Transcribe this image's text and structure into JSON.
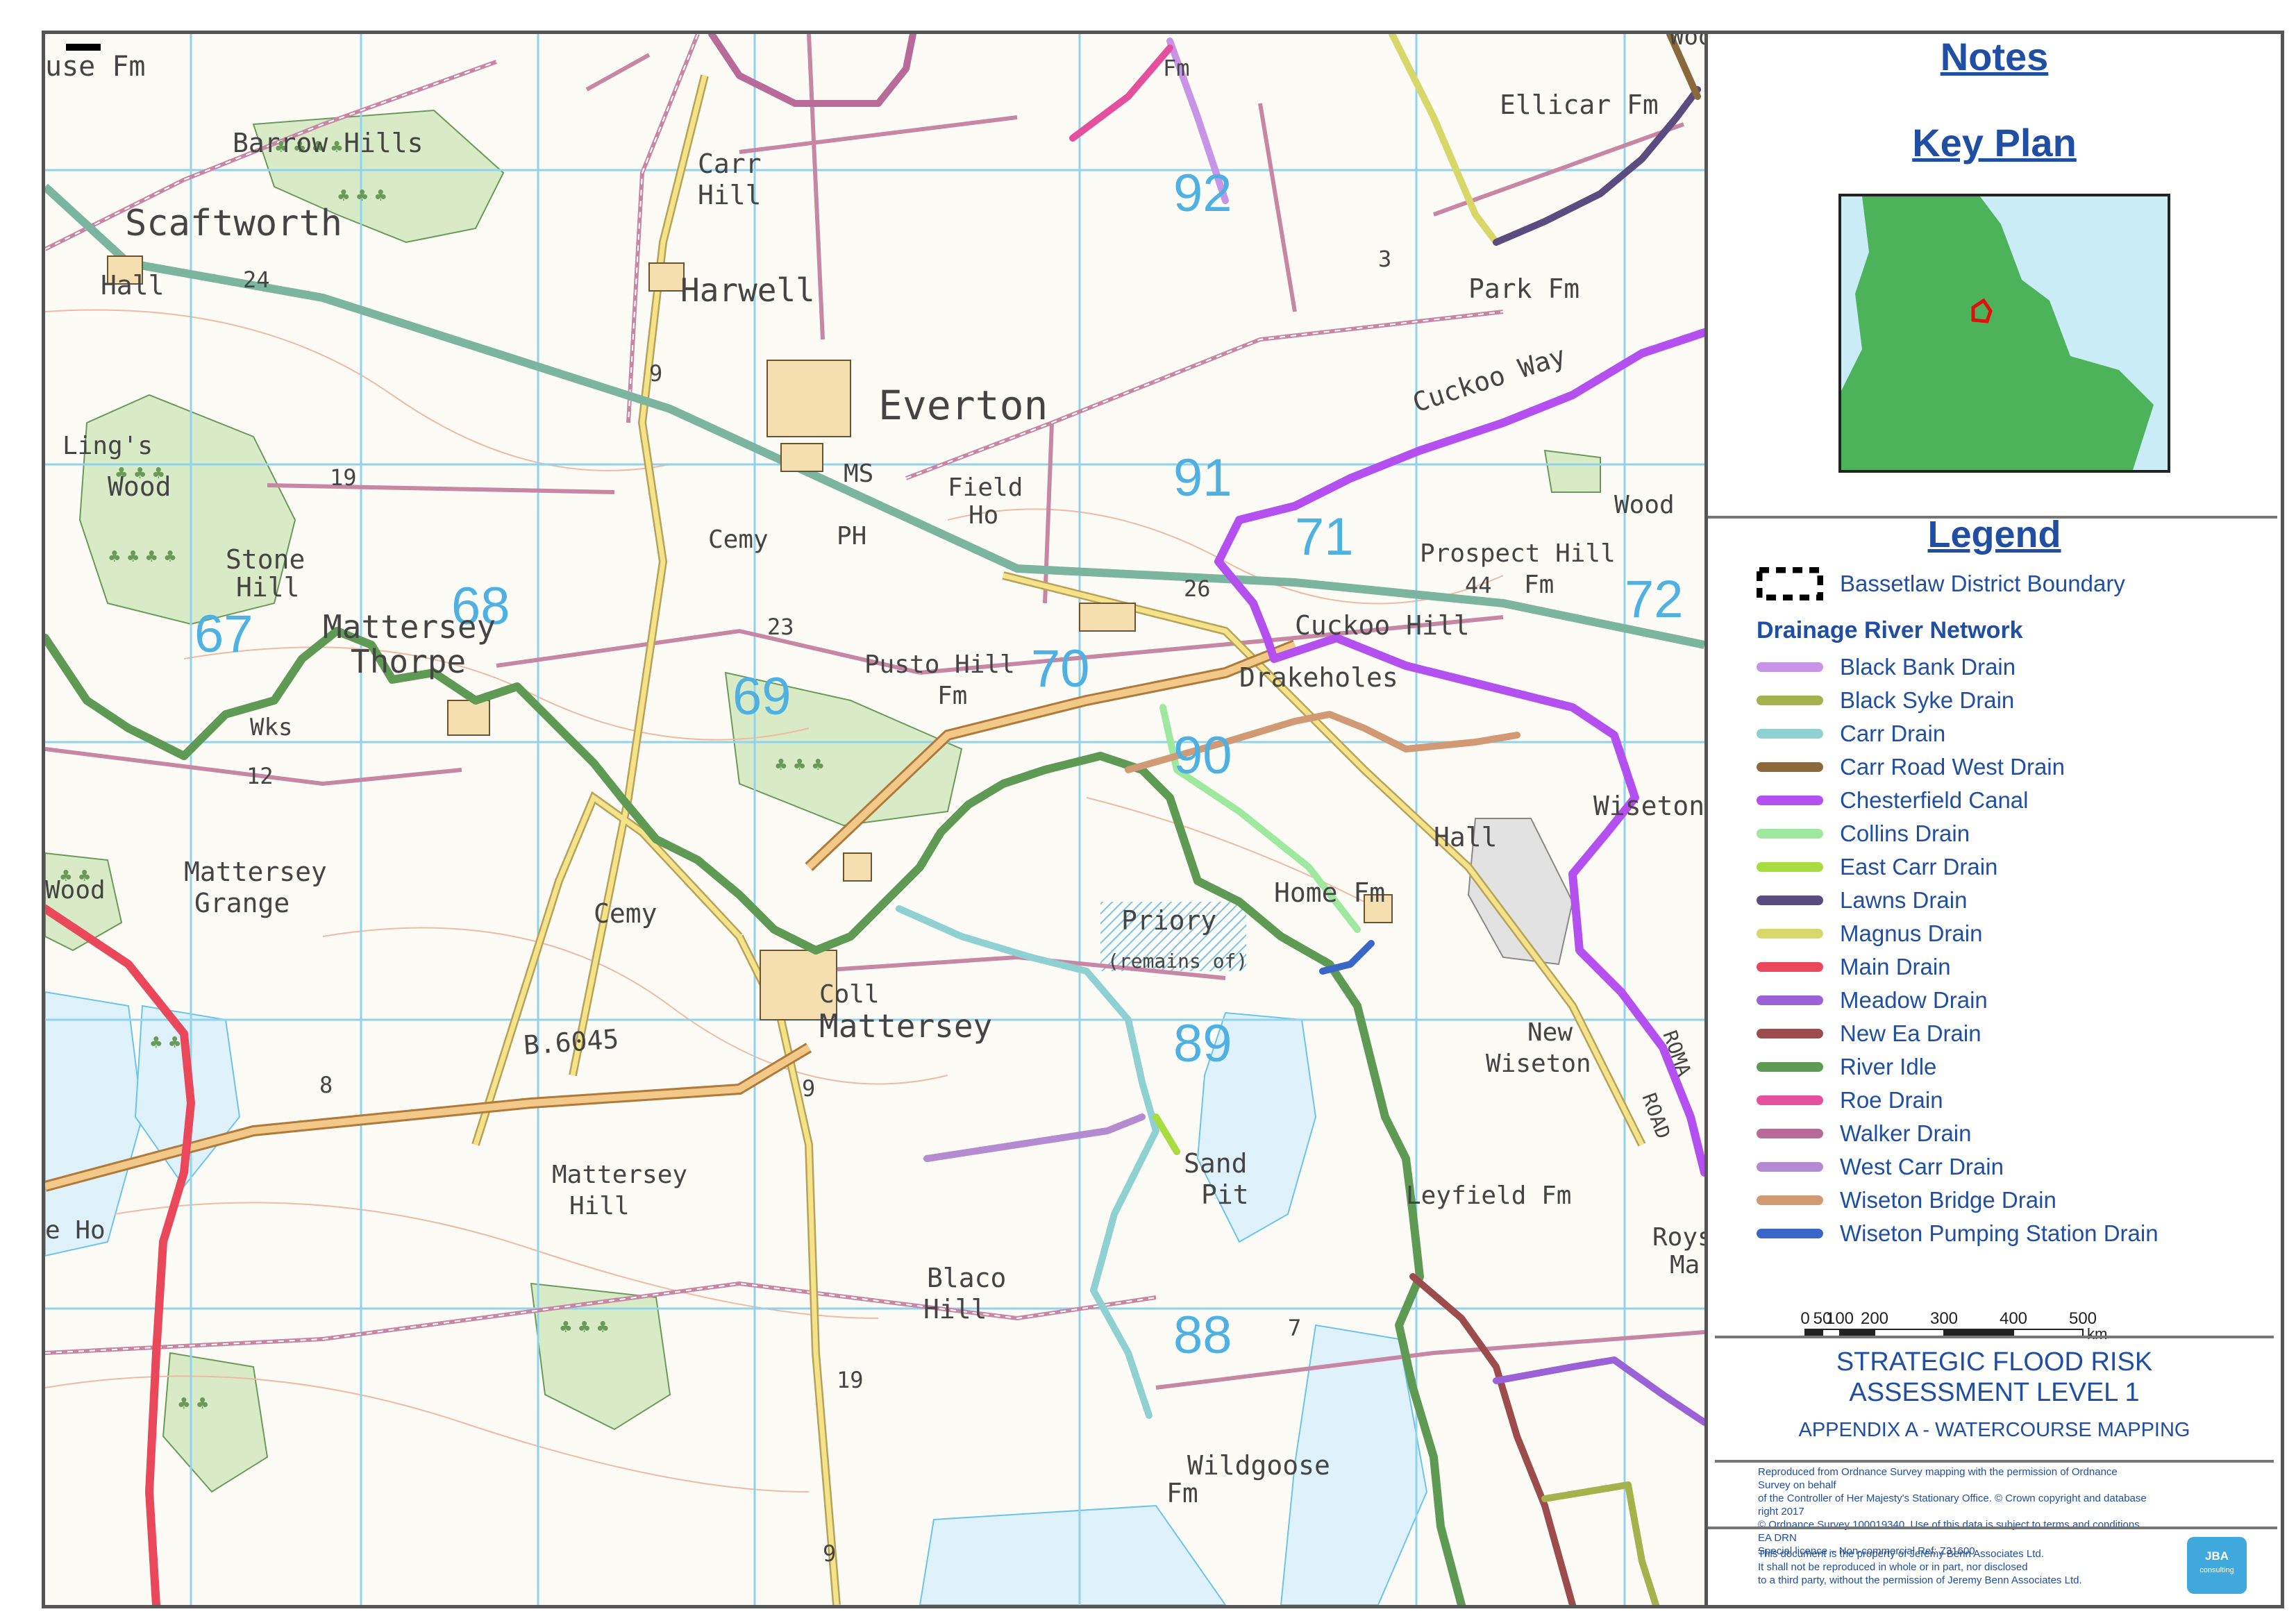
{
  "panel": {
    "notes_title": "Notes",
    "key_plan_title": "Key Plan",
    "legend_title": "Legend",
    "boundary_label": "Bassetlaw District Boundary",
    "network_heading": "Drainage River Network",
    "drains": [
      {
        "label": "Black Bank Drain",
        "color": "#c794e8"
      },
      {
        "label": "Black Syke Drain",
        "color": "#a3b24b"
      },
      {
        "label": "Carr Drain",
        "color": "#8fd1d3"
      },
      {
        "label": "Carr Road West Drain",
        "color": "#8a6a3c"
      },
      {
        "label": "Chesterfield Canal",
        "color": "#b44ff0"
      },
      {
        "label": "Collins Drain",
        "color": "#9fe89f"
      },
      {
        "label": "East Carr Drain",
        "color": "#a9dc3e"
      },
      {
        "label": "Lawns Drain",
        "color": "#5a4c7e"
      },
      {
        "label": "Magnus Drain",
        "color": "#d8d86a"
      },
      {
        "label": "Main Drain",
        "color": "#e8485a"
      },
      {
        "label": "Meadow Drain",
        "color": "#9a62d6"
      },
      {
        "label": "New Ea Drain",
        "color": "#9c4c4c"
      },
      {
        "label": "River Idle",
        "color": "#5f9a55"
      },
      {
        "label": "Roe Drain",
        "color": "#e44f9e"
      },
      {
        "label": "Walker Drain",
        "color": "#b86a98"
      },
      {
        "label": "West Carr Drain",
        "color": "#b48ad0"
      },
      {
        "label": "Wiseton Bridge Drain",
        "color": "#d29a74"
      },
      {
        "label": "Wiseton Pumping Station Drain",
        "color": "#3a66c8"
      }
    ],
    "scale": {
      "ticks": [
        "0",
        "50",
        "100",
        "200",
        "300",
        "400",
        "500"
      ],
      "unit": "km"
    },
    "title_line1": "STRATEGIC FLOOD RISK",
    "title_line2": "ASSESSMENT LEVEL 1",
    "title_line3": "APPENDIX A - WATERCOURSE MAPPING",
    "copyright": [
      "Reproduced from Ordnance Survey mapping with the permission of Ordnance Survey on behalf",
      "of the Controller of Her Majesty's Stationary Office. © Crown copyright and database right 2017",
      "© Ordnance Survey 100019340. Use of this data is subject to terms and conditions. EA DRN",
      "Special licence – Non-commercial Ref: Z31600"
    ],
    "disclaimer": [
      "This document is the property of Jeremy Benn Associates Ltd.",
      "It shall not be reproduced in whole or in part, nor disclosed",
      "to a third party, without the permission of Jeremy Benn Associates Ltd."
    ],
    "logo_text": "JBA",
    "logo_sub": "consulting"
  },
  "map": {
    "grid_labels": [
      "92",
      "91",
      "90",
      "89",
      "88",
      "67",
      "68",
      "69",
      "70",
      "71",
      "72"
    ],
    "places": [
      "use Fm",
      "Barrow Hills",
      "Scaftworth",
      "Hall",
      "Carr",
      "Hill",
      "Harwell",
      "Everton",
      "Ling's",
      "Wood",
      "Stone",
      "Hill",
      "Mattersey",
      "Thorpe",
      "Wks",
      "Cemy",
      "PH",
      "MS",
      "Field",
      "Ho",
      "Pusto Hill",
      "Fm",
      "Drakeholes",
      "Cuckoo Hill",
      "Prospect Hill",
      "Fm",
      "Cuckoo Way",
      "Ellicar Fm",
      "Park Fm",
      "Home Fm",
      "Priory",
      "(remains of)",
      "Hall",
      "Wiseton",
      "Mattersey",
      "Grange",
      "Cemy",
      "Coll",
      "Mattersey",
      "B.6045",
      "Sand",
      "Pit",
      "New",
      "Wiseton",
      "Leyfield Fm",
      "Mattersey",
      "Hill",
      "Blaco",
      "Hill",
      "Wildgoose",
      "Fm",
      "Roys",
      "Ma",
      "e Ho",
      "Wood",
      "ROMA",
      "ROAD",
      "Wood",
      "Fm",
      "Wood"
    ],
    "spot_heights": [
      "24",
      "9",
      "19",
      "26",
      "44",
      "23",
      "12",
      "8",
      "9",
      "19",
      "7",
      "9",
      "3"
    ]
  }
}
